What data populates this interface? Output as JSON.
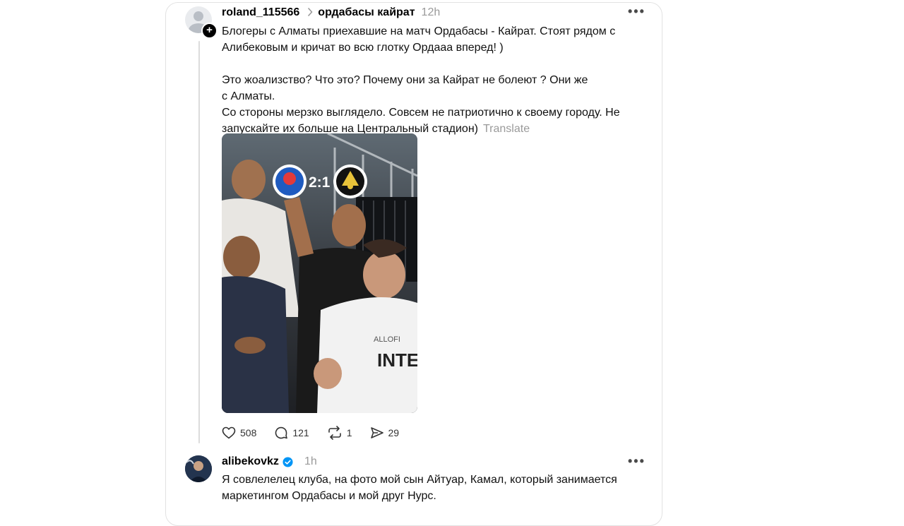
{
  "post": {
    "username": "roland_115566",
    "chevron_icon": "chevron-right-icon",
    "community": "ордабасы кайрат",
    "time": "12h",
    "more_label": "•••",
    "text_lines": [
      "Блогеры с Алматы приехавшие на матч Ордабасы - Кайрат. Стоят рядом с",
      "Алибековым и кричат во всю глотку Ордааа вперед! )"
    ],
    "text_lines_2": [
      "Это жоализство? Что это? Почему они за Кайрат не болеют ? Они же",
      "с Алматы.",
      "Со стороны мерзко выглядело. Совсем не патриотично к своему городу. Не"
    ],
    "last_line": "запускайте их больше на Центральный стадион)",
    "translate_label": "Translate",
    "photo": {
      "score": "2:1",
      "shirt_text": "INTEG",
      "shirt_brand": "ALLOFI"
    },
    "actions": {
      "likes": "508",
      "comments": "121",
      "reposts": "1",
      "shares": "29"
    }
  },
  "reply": {
    "username": "alibekovkz",
    "time": "1h",
    "more_label": "•••",
    "text_lines": [
      "Я совлелелец клуба, на фото мой сын Айтуар, Камал, который занимается",
      "маркетингом Ордабасы и мой друг Нурс."
    ],
    "verified_color": "#0095f6"
  },
  "colors": {
    "muted": "#9a9a9a",
    "border": "#e2e2e2",
    "thread_line": "#dcdcdc"
  }
}
